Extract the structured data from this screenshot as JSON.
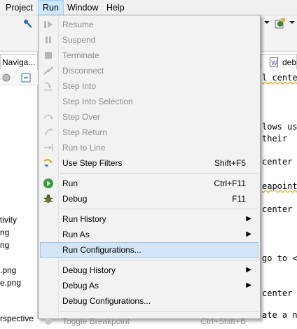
{
  "menubar": {
    "items": [
      {
        "label": "Project"
      },
      {
        "label": "Run"
      },
      {
        "label": "Window"
      },
      {
        "label": "Help"
      }
    ]
  },
  "left_pane": {
    "tab_label": "Naviga...",
    "partial_lines": [
      "tivity",
      "ng",
      "ng",
      ".png",
      "e.png",
      "rspective"
    ]
  },
  "editor": {
    "tab_label": "debu",
    "code_lines": [
      "l cente",
      "lows us",
      " their",
      " center",
      "eapoint",
      " center",
      "go to <",
      " center",
      "ate a n"
    ]
  },
  "run_menu": {
    "items": [
      {
        "label": "Resume",
        "accel": "",
        "icon": "resume-icon",
        "enabled": false
      },
      {
        "label": "Suspend",
        "accel": "",
        "icon": "suspend-icon",
        "enabled": false
      },
      {
        "label": "Terminate",
        "accel": "",
        "icon": "terminate-icon",
        "enabled": false
      },
      {
        "label": "Disconnect",
        "accel": "",
        "icon": "disconnect-icon",
        "enabled": false
      },
      {
        "label": "Step Into",
        "accel": "",
        "icon": "step-into-icon",
        "enabled": false
      },
      {
        "label": "Step Into Selection",
        "accel": "",
        "icon": "step-into-selection-icon",
        "enabled": false
      },
      {
        "label": "Step Over",
        "accel": "",
        "icon": "step-over-icon",
        "enabled": false
      },
      {
        "label": "Step Return",
        "accel": "",
        "icon": "step-return-icon",
        "enabled": false
      },
      {
        "label": "Run to Line",
        "accel": "",
        "icon": "run-to-line-icon",
        "enabled": false
      },
      {
        "label": "Use Step Filters",
        "accel": "Shift+F5",
        "icon": "step-filters-icon",
        "enabled": true
      },
      {
        "label": "Run",
        "accel": "Ctrl+F11",
        "icon": "run-icon",
        "enabled": true
      },
      {
        "label": "Debug",
        "accel": "F11",
        "icon": "debug-icon",
        "enabled": true
      },
      {
        "label": "Run History",
        "accel": "",
        "icon": "",
        "enabled": true,
        "submenu": true
      },
      {
        "label": "Run As",
        "accel": "",
        "icon": "",
        "enabled": true,
        "submenu": true
      },
      {
        "label": "Run Configurations...",
        "accel": "",
        "icon": "",
        "enabled": true,
        "highlighted": true
      },
      {
        "label": "Debug History",
        "accel": "",
        "icon": "",
        "enabled": true,
        "submenu": true
      },
      {
        "label": "Debug As",
        "accel": "",
        "icon": "",
        "enabled": true,
        "submenu": true
      },
      {
        "label": "Debug Configurations...",
        "accel": "",
        "icon": "",
        "enabled": true
      },
      {
        "label": "Toggle Breakpoint",
        "accel": "Ctrl+Shift+B",
        "icon": "toggle-breakpoint-icon",
        "enabled": false
      }
    ]
  },
  "colors": {
    "menu_bg": "#f2f2f2",
    "highlight_bg": "#d4e5f7",
    "disabled_text": "#8d8d8d",
    "run_green": "#2f9e3b"
  }
}
